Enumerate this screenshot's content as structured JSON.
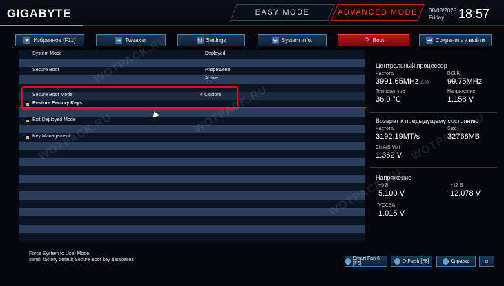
{
  "header": {
    "logo": "GIGABYTE",
    "easy_mode": "EASY MODE",
    "advanced_mode": "ADVANCED MODE",
    "date": "08/08/2025",
    "day": "Friday",
    "time": "18:57"
  },
  "tabs": [
    {
      "label": "Избранное (F11)",
      "icon": "star-icon"
    },
    {
      "label": "Tweaker",
      "icon": "tweaker-icon"
    },
    {
      "label": "Settings",
      "icon": "gear-icon"
    },
    {
      "label": "System Info.",
      "icon": "info-icon"
    },
    {
      "label": "Boot",
      "icon": "power-icon",
      "active": true
    },
    {
      "label": "Сохранить и выйти",
      "icon": "exit-icon"
    }
  ],
  "settings": [
    {
      "label": "System Mode",
      "value": "Deployed"
    },
    {
      "label": "Secure Boot",
      "value": "Разрешено"
    },
    {
      "label": "",
      "value": "Active"
    },
    {
      "label": "Secure Boot Mode",
      "value": "Custom"
    },
    {
      "label": "Restore Factory Keys",
      "value": ""
    },
    {
      "label": "Exit Deployed Mode",
      "value": ""
    },
    {
      "label": "Key Management",
      "value": ""
    }
  ],
  "watermark": "WOTPACK.RU",
  "cpu": {
    "title": "Центральный процессор",
    "freq_label": "Частота",
    "freq_value": "3991.65MHz",
    "freq_suffix": "0.00",
    "bclk_label": "BCLK",
    "bclk_value": "99.75MHz",
    "temp_label": "Температура",
    "temp_value": "36.0 °C",
    "volt_label": "Напряжение",
    "volt_value": "1.158 V"
  },
  "memory": {
    "title": "Возврат к предыдущему состоянию",
    "freq_label": "Частота",
    "freq_value": "3192.19MT/s",
    "size_label": "Size",
    "size_value": "32768MB",
    "volt_label": "Ch A/B Volt",
    "volt_value": "1.362 V"
  },
  "voltage": {
    "title": "Напряжение",
    "v5_label": "+5 В",
    "v5_value": "5.100 V",
    "v12_label": "+12 В",
    "v12_value": "12.078 V",
    "vccsa_label": "VCCSA",
    "vccsa_value": "1.015 V"
  },
  "help": {
    "line1": "Force System to User Mode.",
    "line2": "Install factory default Secure Boot key databases"
  },
  "footer": {
    "smartfan": "Smart Fan 6 [F6]",
    "qflash": "Q-Flash [F8]",
    "help": "Справка"
  }
}
